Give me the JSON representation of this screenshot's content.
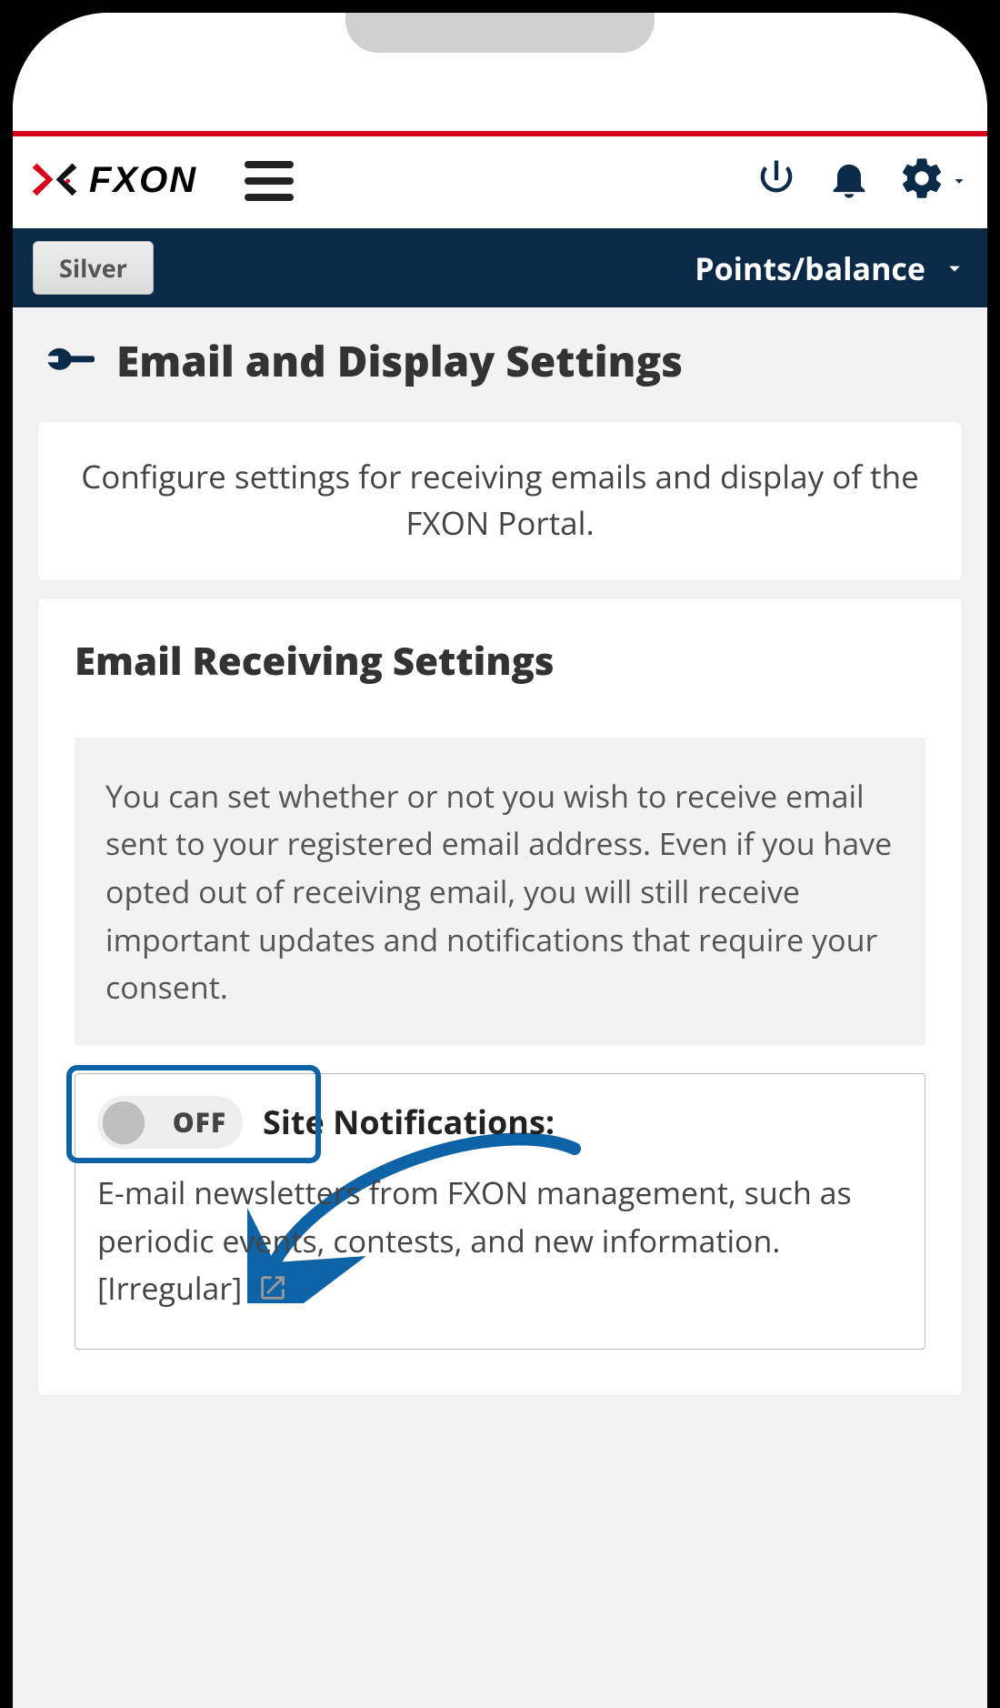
{
  "header": {
    "brand_text": "FXON",
    "tier_label": "Silver",
    "points_label": "Points/balance"
  },
  "page": {
    "title": "Email and Display Settings",
    "intro": "Configure settings for receiving emails and display of the FXON Portal."
  },
  "email_section": {
    "title": "Email Receiving Settings",
    "description": "You can set whether or not you wish to receive email sent to your registered email address. Even if you have opted out of receiving email, you will still receive important updates and notifications that require your consent."
  },
  "toggle": {
    "state": "OFF",
    "label": "Site Notifications:",
    "description": "E-mail newsletters from FXON management, such as periodic events, contests, and new information. [Irregular]"
  }
}
